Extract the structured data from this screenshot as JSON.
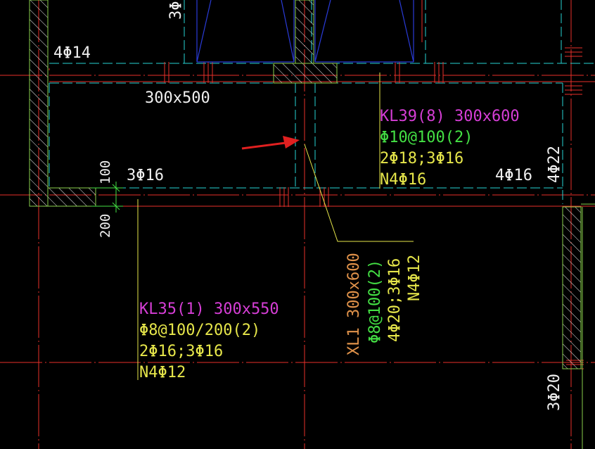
{
  "colors": {
    "background": "#000000",
    "axis_red": "#e8302a",
    "beam_cyan": "#26d3d3",
    "column_green": "#8ad04c",
    "label_white": "#f0f0f0",
    "label_magenta": "#d63ed6",
    "label_yellow": "#e6e64a",
    "label_green": "#44e044",
    "label_orange": "#e0924a",
    "window_blue": "#2a3bd8",
    "arrow_red": "#e02020"
  },
  "labels": {
    "top_left_rebar": "4Φ14",
    "top_vertical_rebar": "3Φ",
    "top_beam_size": "300x500",
    "left_bottom_rebar": "3Φ16",
    "dim_100": "100",
    "dim_200": "200",
    "right_bottom_rebar": "4Φ16",
    "right_vertical_rebar": "4Φ22",
    "bottom_right_vertical": "3Φ20"
  },
  "kl39": {
    "name": "KL39(8) 300x600",
    "stirrup": "Φ10@100(2)",
    "main_bars": "2Φ18;3Φ16",
    "torsion": "N4Φ16"
  },
  "kl35": {
    "name": "KL35(1) 300x550",
    "stirrup": "Φ8@100/200(2)",
    "main_bars": "2Φ16;3Φ16",
    "torsion": "N4Φ12"
  },
  "xl1": {
    "name": "XL1 300x600",
    "stirrup": "Φ8@100(2)",
    "main_bars": "4Φ20;3Φ16",
    "torsion": "N4Φ12"
  },
  "icons": {
    "pointer": "red-arrow-icon",
    "hatch": "concrete-hatch-icon"
  }
}
